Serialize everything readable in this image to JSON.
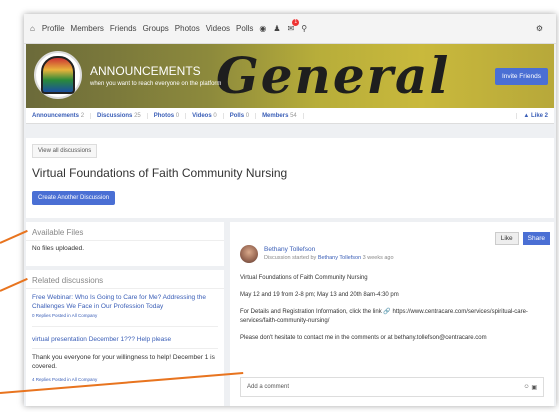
{
  "nav": {
    "items": [
      "Profile",
      "Members",
      "Friends",
      "Groups",
      "Photos",
      "Videos",
      "Polls"
    ],
    "notification_count": "1"
  },
  "banner": {
    "word": "General",
    "title": "ANNOUNCEMENTS",
    "subtitle": "when you want to reach everyone on the platform",
    "invite_label": "Invite Friends"
  },
  "tabs": [
    {
      "label": "Announcements",
      "count": "2"
    },
    {
      "label": "Discussions",
      "count": "25"
    },
    {
      "label": "Photos",
      "count": "0"
    },
    {
      "label": "Videos",
      "count": "0"
    },
    {
      "label": "Polls",
      "count": "0"
    },
    {
      "label": "Members",
      "count": "54"
    }
  ],
  "like_tab": "Like 2",
  "discussion": {
    "view_all": "View all discussions",
    "title": "Virtual Foundations of Faith Community Nursing",
    "create_label": "Create Another Discussion"
  },
  "files": {
    "heading": "Available Files",
    "message": "No files uploaded."
  },
  "related": {
    "heading": "Related discussions",
    "items": [
      {
        "title": "Free Webinar: Who Is Going to Care for Me? Addressing the Challenges We Face in Our Profession Today",
        "meta": "0 Replies Posted in All Company"
      },
      {
        "title": "virtual presentation December 1??? Help please",
        "text": "Thank you everyone for your willingness to help! December 1 is covered.",
        "meta": "4 Replies Posted in All Company"
      }
    ]
  },
  "post": {
    "like_label": "Like",
    "share_label": "Share",
    "author": "Bethany Tollefson",
    "meta_prefix": "Discussion started by",
    "meta_author": "Bethany Tollefson",
    "meta_time": "3 weeks ago",
    "paragraphs": [
      "Virtual Foundations of Faith Community Nursing",
      "May 12 and 19 from 2-8 pm; May 13 and 20th 8am-4:30 pm",
      "For Details and Registration Information, click the link 🔗 https://www.centracare.com/services/spiritual-care-services/faith-community-nursing/",
      "Please don't hesitate to contact me in the comments or at bethany.tollefson@centracare.com"
    ],
    "comment_placeholder": "Add a comment"
  },
  "colors": {
    "accent": "#4a6fd4",
    "link": "#3a5eb7",
    "annotation_arrow": "#e8741f"
  }
}
